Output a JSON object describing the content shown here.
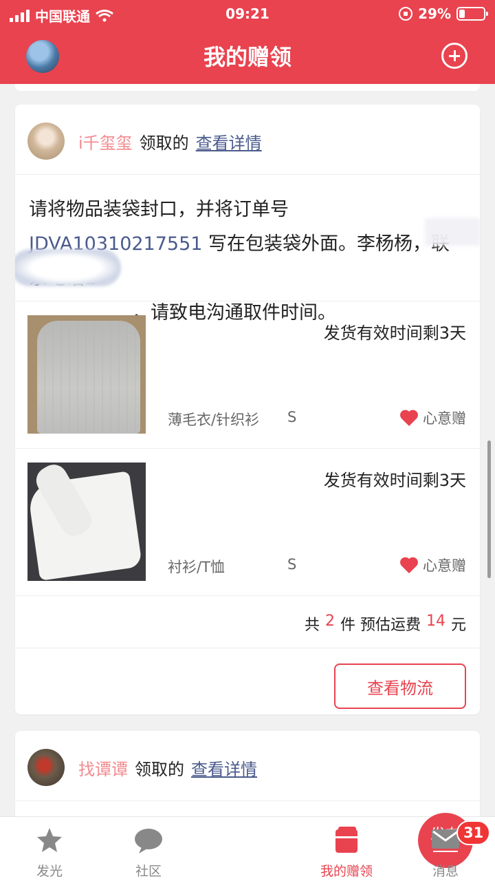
{
  "status_bar": {
    "carrier": "中国联通",
    "time": "09:21",
    "battery": "29%"
  },
  "header": {
    "title": "我的赠领"
  },
  "cards": [
    {
      "username": "i千玺玺",
      "action": "领取的",
      "detail_link": "查看详情",
      "note_part1": "请将物品装袋封口，并将订单号 ",
      "order_no": "JDVA10310217551",
      "note_part2": " 写在包装袋外面。李杨杨，联系电话1",
      "note_part3": "，请致电沟通取件时间。",
      "items": [
        {
          "deadline": "发货有效时间剩3天",
          "category": "薄毛衣/针织衫",
          "size": "S",
          "gift": "心意赠"
        },
        {
          "deadline": "发货有效时间剩3天",
          "category": "衬衫/T恤",
          "size": "S",
          "gift": "心意赠"
        }
      ],
      "summary": {
        "prefix": "共",
        "count": "2",
        "unit": "件 预估运费",
        "fee": "14",
        "currency": "元"
      },
      "logistics_button": "查看物流"
    },
    {
      "username": "找谭谭",
      "action": "领取的",
      "detail_link": "查看详情"
    }
  ],
  "tabs": [
    {
      "label": "发光",
      "icon": "star-icon"
    },
    {
      "label": "社区",
      "icon": "chat-bubble-icon"
    },
    {
      "label": "发布",
      "icon": "publish-icon"
    },
    {
      "label": "我的赠领",
      "icon": "gift-box-icon"
    },
    {
      "label": "消息",
      "icon": "mail-icon"
    }
  ],
  "message_badge": "31",
  "colors": {
    "brand": "#e8434f",
    "link": "#4a5a8c",
    "username": "#f28a8e"
  }
}
